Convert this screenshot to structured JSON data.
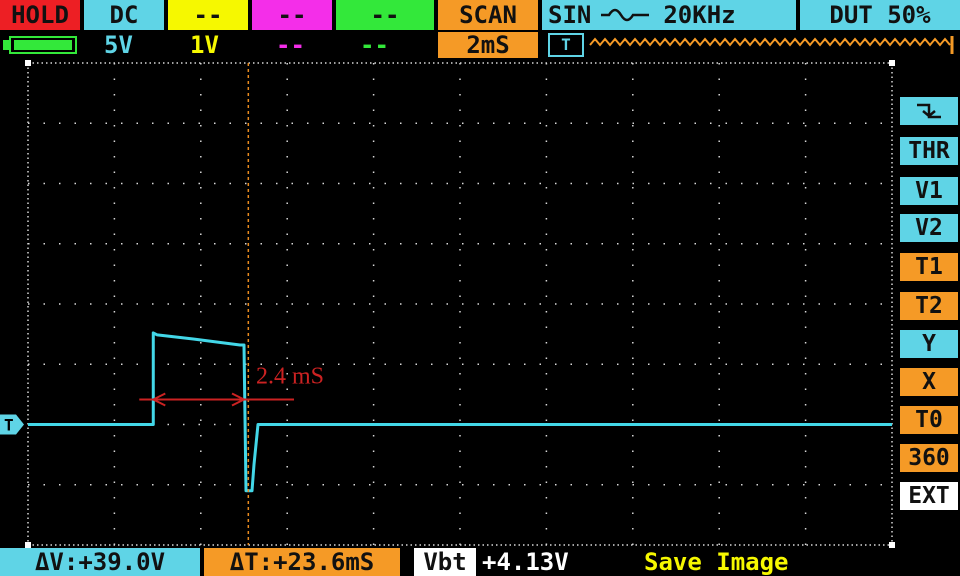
{
  "colors": {
    "cyan": "#5fd4e6",
    "yellow": "#f6f800",
    "magenta": "#f42ee9",
    "green": "#33e83a",
    "orange": "#f59a26",
    "red": "#ed1f24",
    "grid": "#d8d8d8",
    "trace": "#43d7e8",
    "measure": "#cc2222",
    "cursor": "#e98a1e",
    "ext_bg": "#ffffff"
  },
  "top_bar": {
    "hold": "HOLD",
    "ch1_coupling": "DC",
    "ch2_coupling": "--",
    "ch3_coupling": "--",
    "ch4_coupling": "--",
    "mode": "SCAN",
    "generator": {
      "wave": "SIN",
      "wave_icon": "sine-wave-icon",
      "freq": "20KHz",
      "duty": "DUT 50%"
    }
  },
  "second_bar": {
    "battery_icon": "battery-icon",
    "ch1_scale": "5V",
    "ch2_scale": "1V",
    "ch3_scale": "--",
    "ch4_scale": "--",
    "timebase": "2mS",
    "trigger_marker": "T"
  },
  "trace": {
    "ground_level": 0,
    "pulse_start_div": 1.45,
    "pulse_end_div": 2.5,
    "pulse_high_start": 7.6,
    "pulse_high_end": 6.6,
    "undershoot": -5.5
  },
  "measure": {
    "label": "2.4 mS"
  },
  "side_menu": {
    "trigger_edge_icon": "falling-edge-icon",
    "items": [
      "THR",
      "V1",
      "V2",
      "T1",
      "T2",
      "Y",
      "X",
      "T0",
      "360",
      "EXT"
    ]
  },
  "bottom_bar": {
    "delta_v": "ΔV:+39.0V",
    "delta_t": "ΔT:+23.6mS",
    "vbt_label": "Vbt",
    "vbt_value": "+4.13V",
    "save": "Save Image"
  }
}
